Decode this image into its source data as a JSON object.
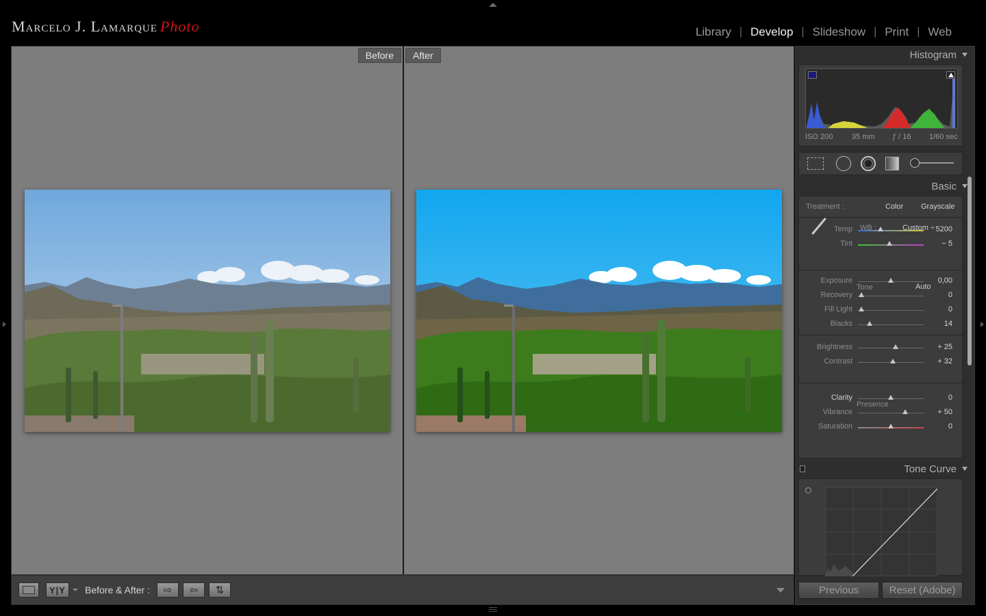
{
  "identity": {
    "name": "Marcelo J. Lamarque",
    "suffix": "Photo"
  },
  "modules": [
    {
      "label": "Library"
    },
    {
      "label": "Develop"
    },
    {
      "label": "Slideshow"
    },
    {
      "label": "Print"
    },
    {
      "label": "Web"
    }
  ],
  "labels": {
    "before": "Before",
    "after": "After"
  },
  "toolbar": {
    "view_mode": "Y|Y",
    "compare_label": "Before & After :"
  },
  "panels": {
    "histogram": {
      "title": "Histogram",
      "iso": "ISO 200",
      "focal": "35 mm",
      "aperture": "ƒ / 16",
      "shutter": "1/60 sec"
    },
    "basic": {
      "title": "Basic",
      "treatment_label": "Treatment :",
      "treatment_color": "Color",
      "treatment_grayscale": "Grayscale",
      "wb_label": "WB :",
      "wb_value": "Custom ÷",
      "tone_label": "Tone",
      "auto_label": "Auto",
      "presence_label": "Presence",
      "sliders": [
        {
          "name": "Temp",
          "value": "5200",
          "pos": 0.34
        },
        {
          "name": "Tint",
          "value": "− 5",
          "pos": 0.48
        },
        {
          "name": "Exposure",
          "value": "0,00",
          "pos": 0.5
        },
        {
          "name": "Recovery",
          "value": "0",
          "pos": 0.05
        },
        {
          "name": "Fill Light",
          "value": "0",
          "pos": 0.05
        },
        {
          "name": "Blacks",
          "value": "14",
          "pos": 0.18
        },
        {
          "name": "Brightness",
          "value": "+ 25",
          "pos": 0.57
        },
        {
          "name": "Contrast",
          "value": "+ 32",
          "pos": 0.53
        },
        {
          "name": "Clarity",
          "value": "0",
          "pos": 0.5
        },
        {
          "name": "Vibrance",
          "value": "+ 50",
          "pos": 0.72
        },
        {
          "name": "Saturation",
          "value": "0",
          "pos": 0.5
        }
      ]
    },
    "tone_curve": {
      "title": "Tone Curve"
    }
  },
  "actions": {
    "previous": "Previous",
    "reset": "Reset (Adobe)"
  },
  "colors": {
    "accent_red": "#d0121b",
    "canvas_gray": "#7d7d7d",
    "panel_bg": "#2e2e2e"
  }
}
